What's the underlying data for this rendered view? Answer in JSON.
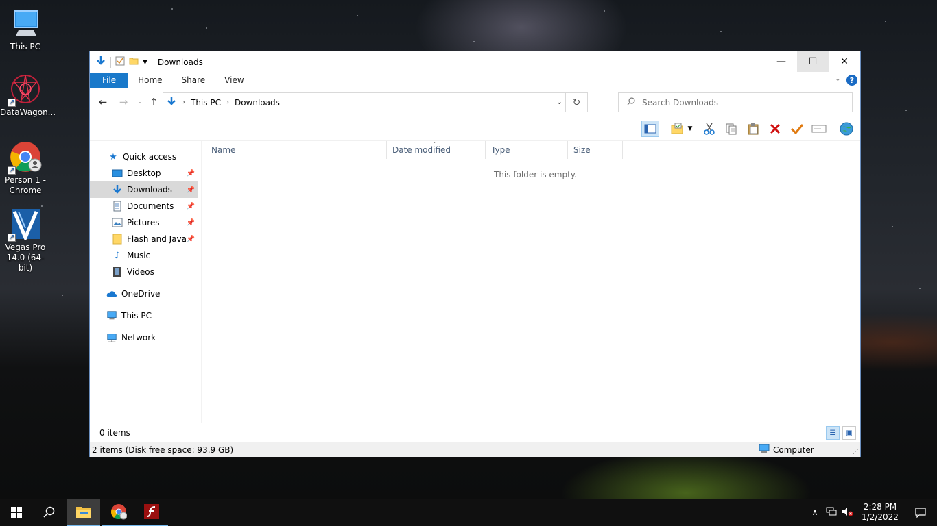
{
  "desktop": {
    "icons": [
      {
        "label": "This PC",
        "icon": "computer-icon"
      },
      {
        "label": "DataWagon...",
        "icon": "datawagon-icon"
      },
      {
        "label": "Person 1 - Chrome",
        "icon": "chrome-icon"
      },
      {
        "label": "Vegas Pro 14.0 (64-bit)",
        "icon": "vegas-pro-icon"
      }
    ]
  },
  "window": {
    "title": "Downloads",
    "ribbon_tabs": [
      "File",
      "Home",
      "Share",
      "View"
    ],
    "address": {
      "crumbs": [
        "This PC",
        "Downloads"
      ]
    },
    "search": {
      "placeholder": "Search Downloads"
    },
    "nav": {
      "quick_access": "Quick access",
      "items": [
        {
          "label": "Desktop",
          "pinned": true
        },
        {
          "label": "Downloads",
          "pinned": true,
          "selected": true
        },
        {
          "label": "Documents",
          "pinned": true
        },
        {
          "label": "Pictures",
          "pinned": true
        },
        {
          "label": "Flash and Java",
          "pinned": true
        },
        {
          "label": "Music",
          "pinned": false
        },
        {
          "label": "Videos",
          "pinned": false
        }
      ],
      "onedrive": "OneDrive",
      "this_pc": "This PC",
      "network": "Network"
    },
    "columns": [
      "Name",
      "Date modified",
      "Type",
      "Size"
    ],
    "empty_message": "This folder is empty.",
    "status": {
      "items": "0 items",
      "disk": "2 items (Disk free space: 93.9 GB)",
      "location": "Computer"
    }
  },
  "taskbar": {
    "time": "2:28 PM",
    "date": "1/2/2022"
  },
  "colors": {
    "accent": "#1979ca",
    "selected_nav": "#d9d9d9"
  }
}
